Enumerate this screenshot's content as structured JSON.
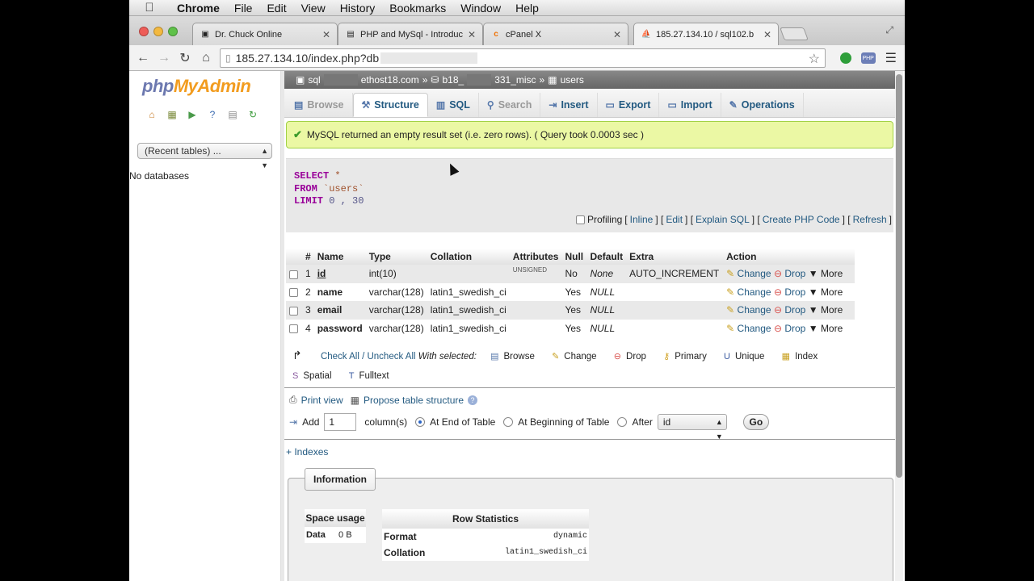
{
  "menubar": {
    "items": [
      "Chrome",
      "File",
      "Edit",
      "View",
      "History",
      "Bookmarks",
      "Window",
      "Help"
    ]
  },
  "browser": {
    "tabs": [
      {
        "title": "Dr. Chuck Online",
        "favicon": "page-icon"
      },
      {
        "title": "PHP and MySql - Introduct",
        "favicon": "doc-icon"
      },
      {
        "title": "cPanel X",
        "favicon": "cpanel-icon"
      },
      {
        "title": "185.27.134.10 / sql102.b",
        "favicon": "pma-icon"
      }
    ],
    "url": "185.27.134.10/index.php?db"
  },
  "sidebar": {
    "logo_php": "php",
    "logo_myadmin": "MyAdmin",
    "recent_tables": "(Recent tables) ...",
    "no_databases": "No databases"
  },
  "breadcrumb": {
    "server_a": "sql",
    "server_b": "ethost18.com",
    "db_a": "b18_",
    "db_b": "331_misc",
    "table": "users",
    "sep": "»"
  },
  "tabs": {
    "browse": "Browse",
    "structure": "Structure",
    "sql": "SQL",
    "search": "Search",
    "insert": "Insert",
    "export": "Export",
    "import": "Import",
    "operations": "Operations"
  },
  "message": "MySQL returned an empty result set (i.e. zero rows). ( Query took 0.0003 sec )",
  "query": {
    "select": "SELECT",
    "star": "*",
    "from": "FROM",
    "table": "`users`",
    "limit": "LIMIT",
    "limit_args": "0 , 30"
  },
  "query_links": {
    "profiling": "Profiling",
    "inline": "Inline",
    "edit": "Edit",
    "explain": "Explain SQL",
    "php_code": "Create PHP Code",
    "refresh": "Refresh"
  },
  "structure_table": {
    "headers": [
      "#",
      "Name",
      "Type",
      "Collation",
      "Attributes",
      "Null",
      "Default",
      "Extra",
      "Action"
    ],
    "rows": [
      {
        "num": "1",
        "name": "id",
        "type": "int(10)",
        "collation": "",
        "attributes": "UNSIGNED",
        "null": "No",
        "default": "None",
        "extra": "AUTO_INCREMENT"
      },
      {
        "num": "2",
        "name": "name",
        "type": "varchar(128)",
        "collation": "latin1_swedish_ci",
        "attributes": "",
        "null": "Yes",
        "default": "NULL",
        "extra": ""
      },
      {
        "num": "3",
        "name": "email",
        "type": "varchar(128)",
        "collation": "latin1_swedish_ci",
        "attributes": "",
        "null": "Yes",
        "default": "NULL",
        "extra": ""
      },
      {
        "num": "4",
        "name": "password",
        "type": "varchar(128)",
        "collation": "latin1_swedish_ci",
        "attributes": "",
        "null": "Yes",
        "default": "NULL",
        "extra": ""
      }
    ],
    "actions": {
      "change": "Change",
      "drop": "Drop",
      "more": "More"
    }
  },
  "with_selected": {
    "check_all": "Check All",
    "slash": "/",
    "uncheck_all": "Uncheck All",
    "label": "With selected:",
    "ops": [
      "Browse",
      "Change",
      "Drop",
      "Primary",
      "Unique",
      "Index",
      "Spatial",
      "Fulltext"
    ]
  },
  "print_view": "Print view",
  "propose": "Propose table structure",
  "add_column": {
    "add": "Add",
    "count": "1",
    "columns": "column(s)",
    "end": "At End of Table",
    "beginning": "At Beginning of Table",
    "after": "After",
    "after_field": "id",
    "go": "Go"
  },
  "indexes": "+ Indexes",
  "information": {
    "title": "Information",
    "space_usage": "Space usage",
    "data_label": "Data",
    "data_value": "0",
    "data_unit": "B",
    "row_stats_title": "Row Statistics",
    "format_label": "Format",
    "format_value": "dynamic",
    "collation_label": "Collation",
    "collation_value": "latin1_swedish_ci"
  }
}
